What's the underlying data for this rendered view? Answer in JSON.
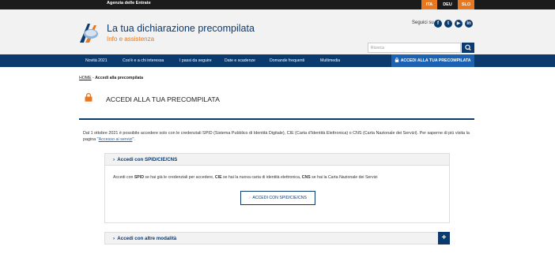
{
  "topbar": {
    "agency": "Agenzia delle Entrate",
    "languages": [
      "ITA",
      "DEU",
      "SLO"
    ]
  },
  "header": {
    "title": "La tua dichiarazione precompilata",
    "subtitle": "Info e assistenza",
    "social_label": "Seguici su",
    "social": [
      "f",
      "t",
      "▶",
      "in"
    ],
    "search_placeholder": "Ricerca"
  },
  "nav": {
    "items": [
      "Novità 2021",
      "Cos'è e a chi interessa",
      "I passi da seguire",
      "Date e scadenze",
      "Domande frequenti",
      "Multimedia"
    ],
    "cta": "ACCEDI ALLA TUA PRECOMPILATA"
  },
  "breadcrumb": {
    "home": "HOME",
    "sep": " - ",
    "current": "Accedi alla precompilata"
  },
  "page_title": "ACCEDI ALLA TUA PRECOMPILATA",
  "intro": {
    "text": "Dal 1 ottobre 2021 è possibile accedere solo con le credenziali SPID (Sistema Pubblico di Identità Digitale), CIE (Carta d'Identità Elettronica) o CNS (Carta Nazionale dei Servizi). Per saperne di più visita la pagina \"",
    "link": "Accesso ai servizi",
    "end": "\"."
  },
  "accordion1": {
    "title": "Accedi con SPID/CIE/CNS",
    "desc_parts": [
      "Accedi con ",
      "SPID",
      " se hai già le credenziali per accedere, ",
      "CIE",
      " se hai la nuova carta di identità elettronica, ",
      "CNS",
      " se hai la Carta Nazionale dei Servizi"
    ],
    "button": "ACCEDI CON SPID/CIE/CNS"
  },
  "accordion2": {
    "title": "Accedi con altre modalità"
  },
  "colors": {
    "primary": "#0b3a6e",
    "accent": "#e87722",
    "header_bg": "#f2f2f2"
  }
}
